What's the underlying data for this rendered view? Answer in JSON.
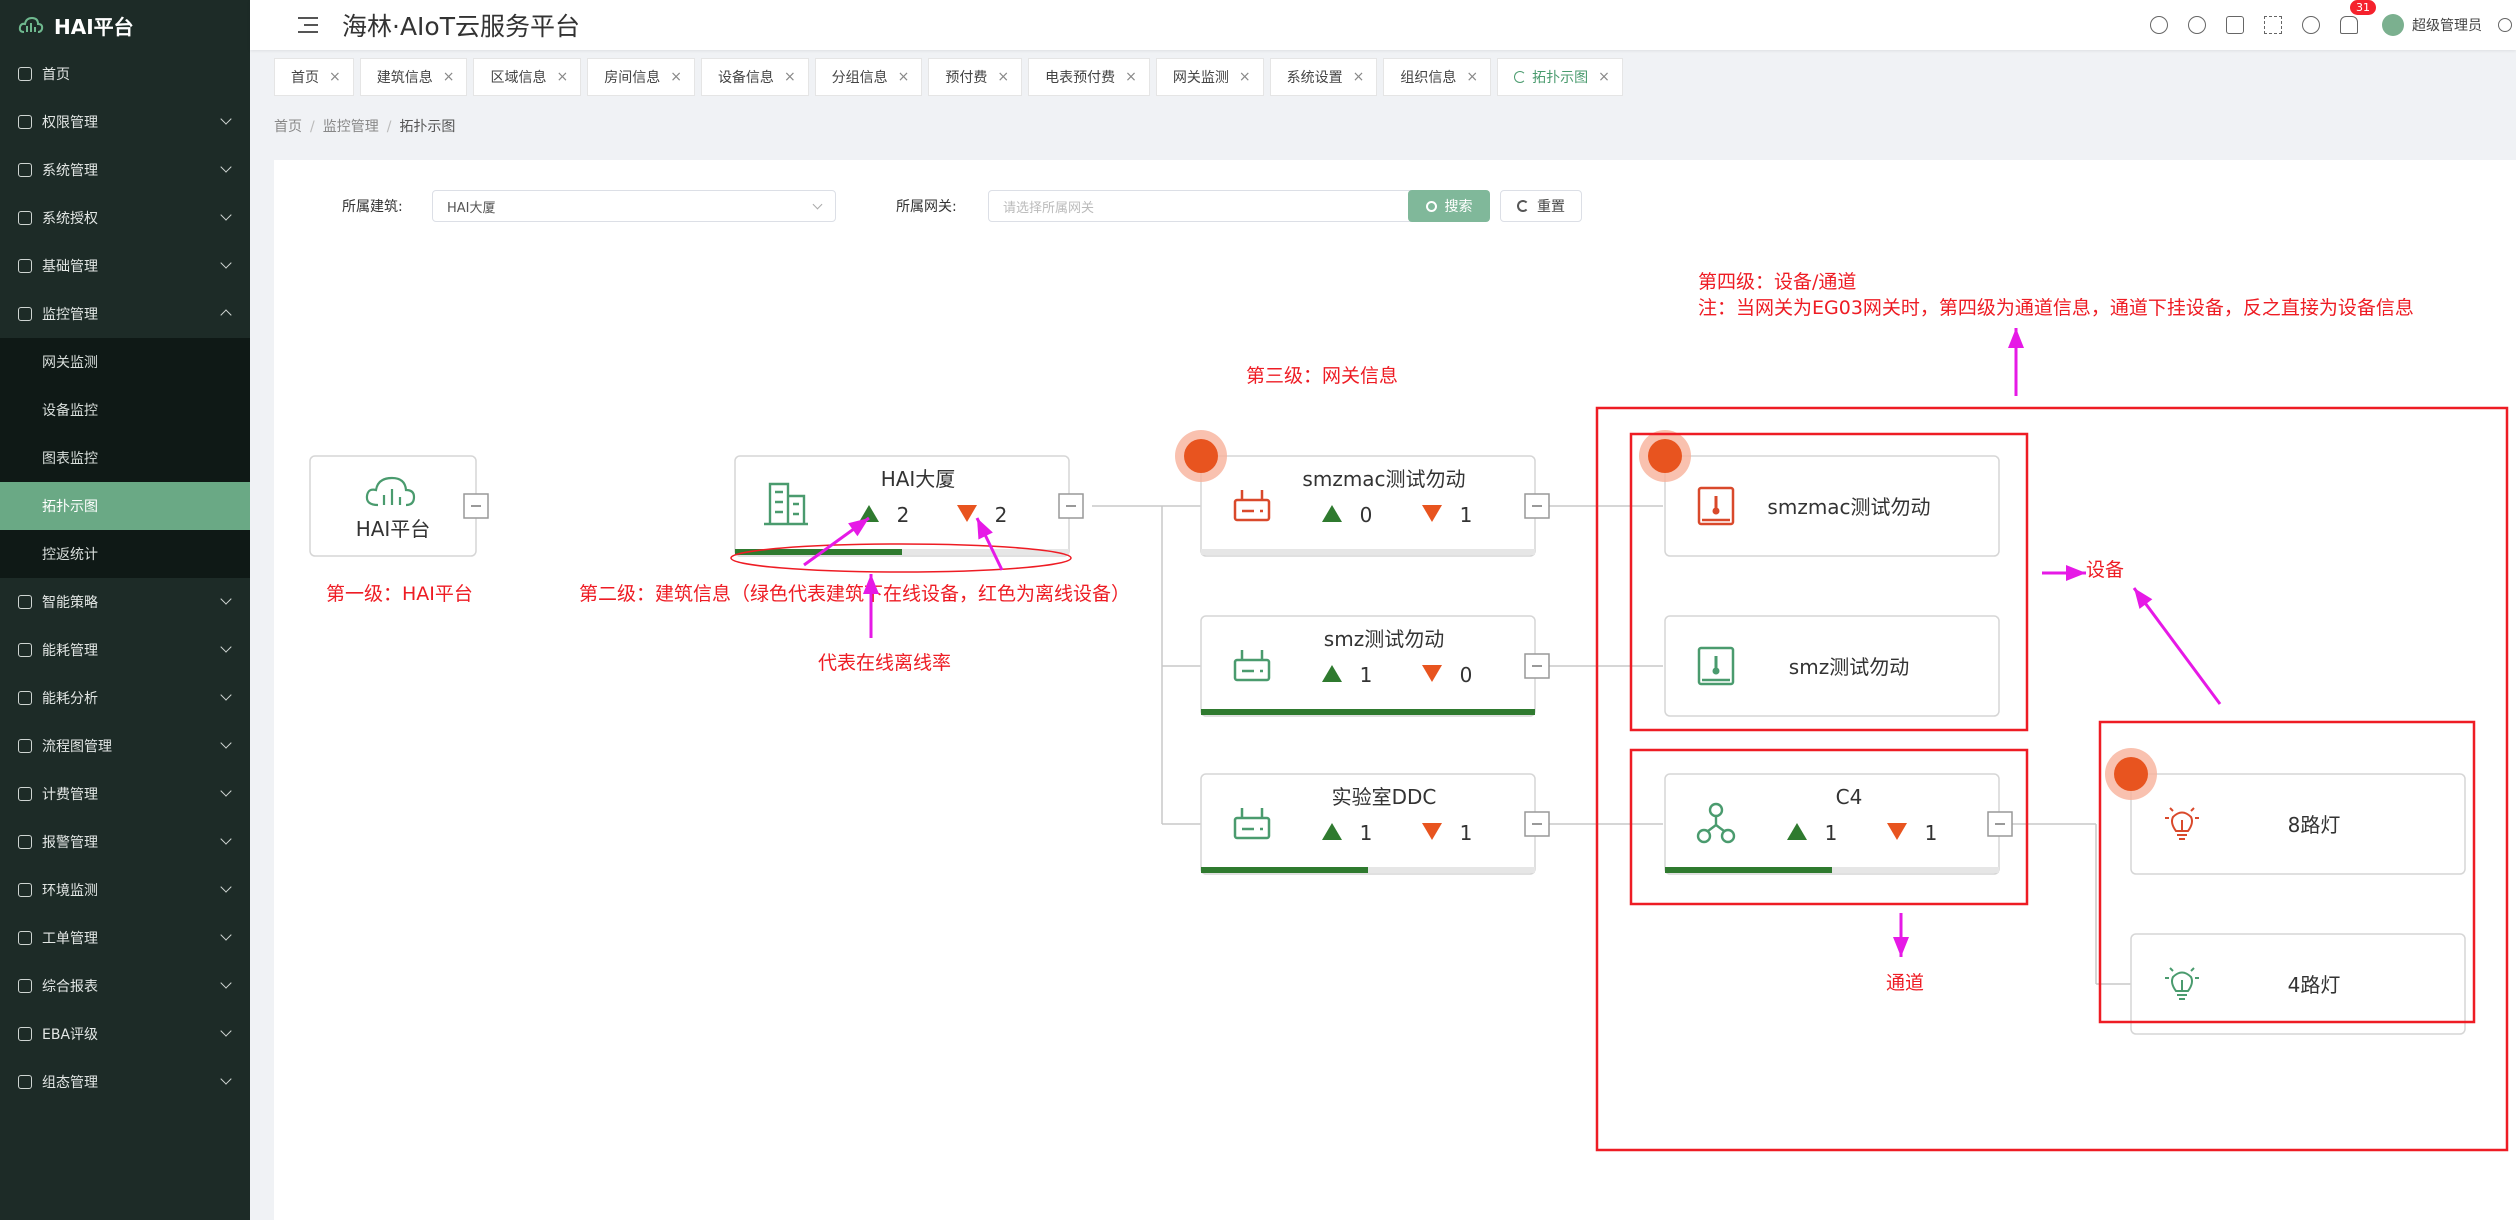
{
  "app": {
    "name": "HAI平台",
    "title": "海林·AIoT云服务平台"
  },
  "header": {
    "notification_count": "31",
    "user": "超级管理员"
  },
  "sidebar": {
    "items": [
      {
        "label": "首页",
        "icon": "home-icon"
      },
      {
        "label": "权限管理",
        "icon": "shield-icon"
      },
      {
        "label": "系统管理",
        "icon": "monitor-icon"
      },
      {
        "label": "系统授权",
        "icon": "key-icon"
      },
      {
        "label": "基础管理",
        "icon": "box-icon"
      },
      {
        "label": "监控管理",
        "icon": "monitor-icon",
        "expanded": true,
        "children": [
          "网关监测",
          "设备监控",
          "图表监控",
          "拓扑示图",
          "控返统计"
        ],
        "active_child": "拓扑示图"
      },
      {
        "label": "智能策略",
        "icon": "pin-icon"
      },
      {
        "label": "能耗管理",
        "icon": "sliders-icon"
      },
      {
        "label": "能耗分析",
        "icon": "chart-icon"
      },
      {
        "label": "流程图管理",
        "icon": "flow-icon"
      },
      {
        "label": "计费管理",
        "icon": "wallet-icon"
      },
      {
        "label": "报警管理",
        "icon": "alarm-icon"
      },
      {
        "label": "环境监测",
        "icon": "leaf-icon"
      },
      {
        "label": "工单管理",
        "icon": "list-icon"
      },
      {
        "label": "综合报表",
        "icon": "report-icon"
      },
      {
        "label": "EBA评级",
        "icon": "bars-icon"
      },
      {
        "label": "组态管理",
        "icon": "config-icon"
      }
    ]
  },
  "tabs": [
    "首页",
    "建筑信息",
    "区域信息",
    "房间信息",
    "设备信息",
    "分组信息",
    "预付费",
    "电表预付费",
    "网关监测",
    "系统设置",
    "组织信息",
    "拓扑示图"
  ],
  "active_tab": "拓扑示图",
  "breadcrumb": [
    "首页",
    "监控管理",
    "拓扑示图"
  ],
  "filters": {
    "building_label": "所属建筑:",
    "building_value": "HAI大厦",
    "gateway_label": "所属网关:",
    "gateway_placeholder": "请选择所属网关",
    "search_label": "搜索",
    "reset_label": "重置"
  },
  "topology": {
    "root": {
      "name": "HAI平台"
    },
    "building": {
      "name": "HAI大厦",
      "online": 2,
      "offline": 2,
      "online_rate": 0.5
    },
    "gateways": [
      {
        "name": "smzmac测试勿动",
        "online": 0,
        "offline": 1,
        "online_rate": 0,
        "alarm": true,
        "status": "offline"
      },
      {
        "name": "smz测试勿动",
        "online": 1,
        "offline": 0,
        "online_rate": 1,
        "alarm": false,
        "status": "online"
      },
      {
        "name": "实验室DDC",
        "online": 1,
        "offline": 1,
        "online_rate": 0.5,
        "alarm": false,
        "status": "online"
      }
    ],
    "devices": [
      {
        "name": "smzmac测试勿动",
        "alarm": true,
        "status": "offline"
      },
      {
        "name": "smz测试勿动",
        "alarm": false,
        "status": "online"
      }
    ],
    "channel": {
      "name": "C4",
      "online": 1,
      "offline": 1,
      "online_rate": 0.5
    },
    "channel_devices": [
      {
        "name": "8路灯",
        "alarm": true,
        "status": "offline"
      },
      {
        "name": "4路灯",
        "alarm": false,
        "status": "online"
      }
    ]
  },
  "annotations": {
    "level1": "第一级：HAI平台",
    "level2": "第二级：建筑信息（绿色代表建筑下在线设备，红色为离线设备）",
    "online_rate": "代表在线离线率",
    "level3": "第三级：网关信息",
    "level4_title": "第四级：设备/通道",
    "level4_note": "注：当网关为EG03网关时，第四级为通道信息，通道下挂设备，反之直接为设备信息",
    "device": "设备",
    "channel": "通道"
  },
  "colors": {
    "sidebar_bg": "#1d2b27",
    "sidebar_active": "#6aa985",
    "brand_green": "#4a9b6e",
    "online_green": "#2f7a2f",
    "offline_orange": "#e8541f",
    "annotation_red": "#ee1c24",
    "annotation_magenta": "#e619e6"
  }
}
